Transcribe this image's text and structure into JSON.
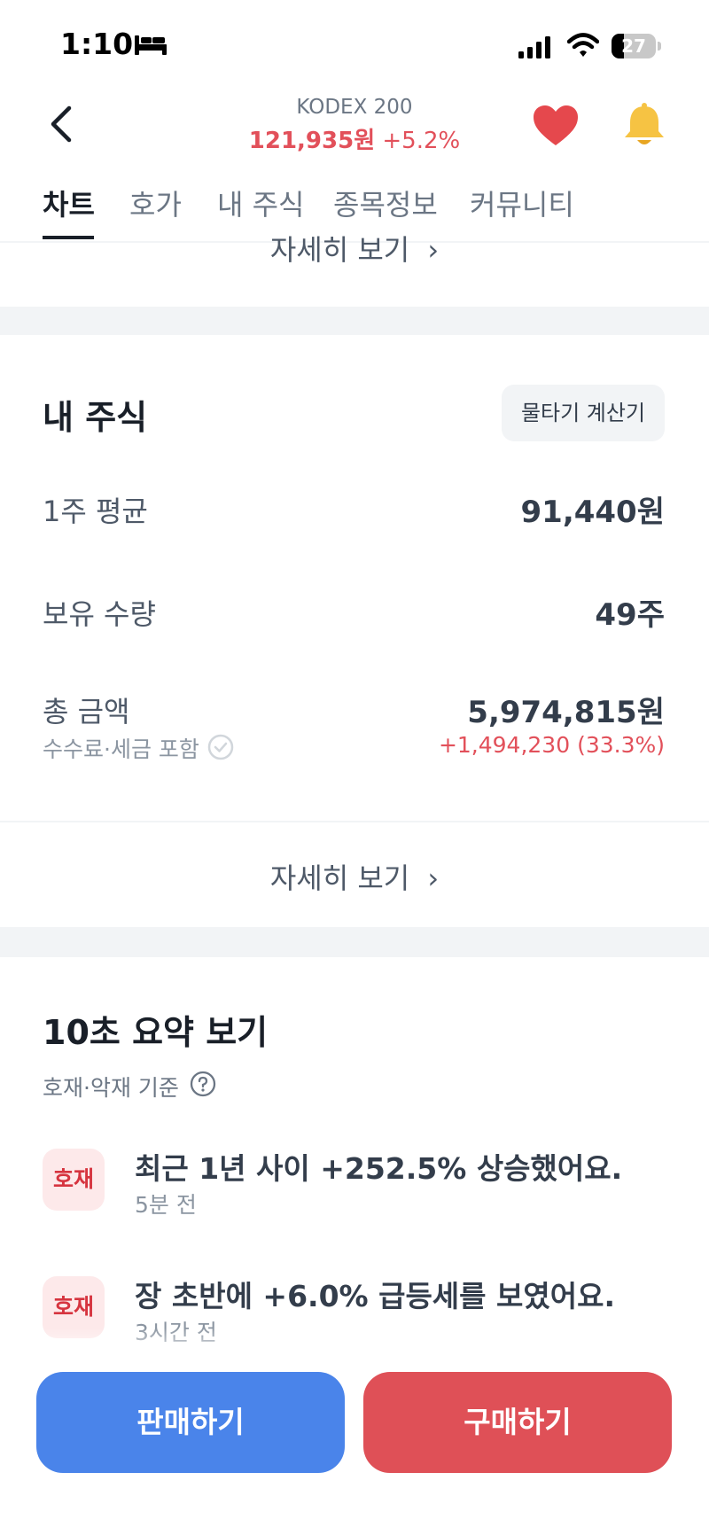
{
  "status_bar": {
    "time": "1:10",
    "battery": "27"
  },
  "header": {
    "stock_name": "KODEX 200",
    "price": "121,935원",
    "change": "+5.2%",
    "colors": {
      "up": "#e2505a",
      "heart": "#e5484d",
      "bell": "#f6c343"
    }
  },
  "tabs": [
    {
      "label": "차트",
      "active": true
    },
    {
      "label": "호가",
      "active": false
    },
    {
      "label": "내 주식",
      "active": false
    },
    {
      "label": "종목정보",
      "active": false
    },
    {
      "label": "커뮤니티",
      "active": false
    }
  ],
  "top_detail_link": "자세히 보기",
  "my_stock": {
    "title": "내 주식",
    "calculator_button": "물타기 계산기",
    "rows": [
      {
        "label": "1주 평균",
        "value": "91,440원"
      },
      {
        "label": "보유 수량",
        "value": "49주"
      },
      {
        "label": "총 금액",
        "value": "5,974,815원"
      }
    ],
    "total_sub_label": "수수료·세금 포함",
    "profit": "+1,494,230 (33.3%)",
    "detail_link": "자세히 보기"
  },
  "summary": {
    "title": "10초 요약 보기",
    "criteria": "호재·악재 기준",
    "items": [
      {
        "badge": "호재",
        "title": "최근 1년 사이 +252.5% 상승했어요.",
        "time": "5분 전"
      },
      {
        "badge": "호재",
        "title": "장 초반에 +6.0% 급등세를 보였어요.",
        "time": "3시간 전"
      }
    ]
  },
  "actions": {
    "sell": "판매하기",
    "buy": "구매하기",
    "colors": {
      "sell": "#4a84ea",
      "buy": "#df5057"
    }
  }
}
